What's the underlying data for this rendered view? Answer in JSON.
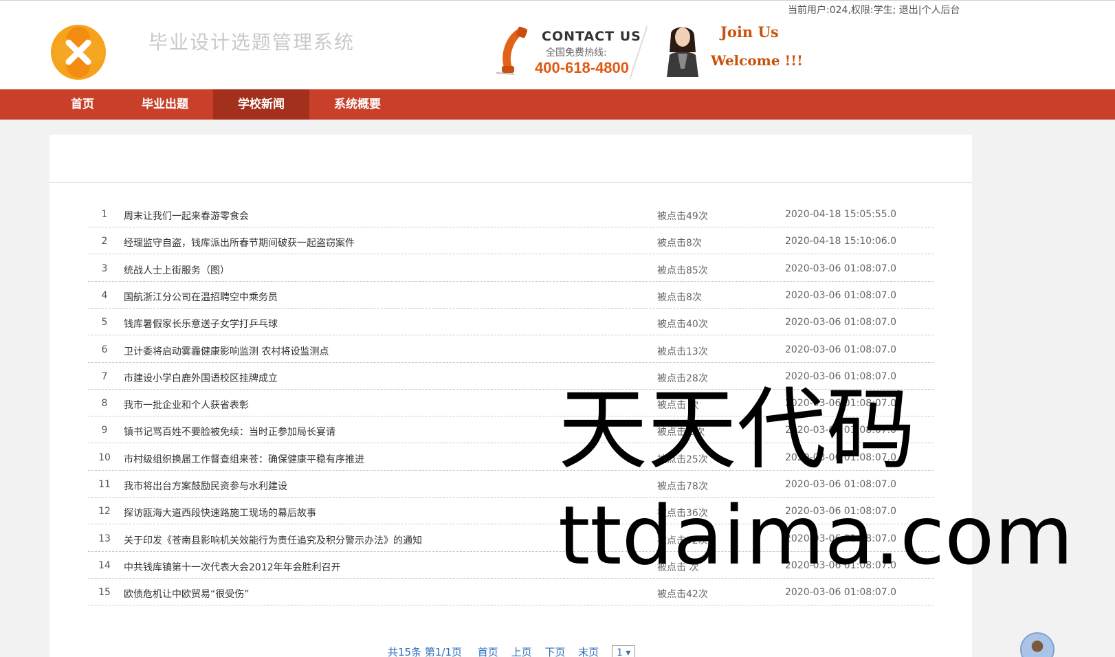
{
  "header": {
    "user_info": "当前用户:024,权限:学生;",
    "logout_label": "退出",
    "separator": "|",
    "dashboard_label": "个人后台",
    "site_title": "毕业设计选题管理系统",
    "contact_title": "CONTACT US",
    "contact_sub": "全国免费热线:",
    "contact_number": "400-618-4800",
    "join_us": "Join Us",
    "welcome": "Welcome !!!"
  },
  "nav": {
    "items": [
      {
        "label": "首页"
      },
      {
        "label": "毕业出题"
      },
      {
        "label": "学校新闻"
      },
      {
        "label": "系统概要"
      }
    ],
    "active_index": 2
  },
  "news": {
    "rows": [
      {
        "num": "1",
        "title": "周末让我们一起来春游零食会",
        "hits": "被点击49次",
        "date": "2020-04-18 15:05:55.0"
      },
      {
        "num": "2",
        "title": "经理监守自盗，钱库派出所春节期间破获一起盗窃案件",
        "hits": "被点击8次",
        "date": "2020-04-18 15:10:06.0"
      },
      {
        "num": "3",
        "title": "统战人士上街服务（图）",
        "hits": "被点击85次",
        "date": "2020-03-06 01:08:07.0"
      },
      {
        "num": "4",
        "title": "国航浙江分公司在温招聘空中乘务员",
        "hits": "被点击8次",
        "date": "2020-03-06 01:08:07.0"
      },
      {
        "num": "5",
        "title": "钱库暑假家长乐意送子女学打乒乓球",
        "hits": "被点击40次",
        "date": "2020-03-06 01:08:07.0"
      },
      {
        "num": "6",
        "title": "卫计委将启动雾霾健康影响监测 农村将设监测点",
        "hits": "被点击13次",
        "date": "2020-03-06 01:08:07.0"
      },
      {
        "num": "7",
        "title": "市建设小学白鹿外国语校区挂牌成立",
        "hits": "被点击28次",
        "date": "2020-03-06 01:08:07.0"
      },
      {
        "num": "8",
        "title": "我市一批企业和个人获省表彰",
        "hits": "被点击 次",
        "date": "2020-03-06 01:08:07.0"
      },
      {
        "num": "9",
        "title": "镇书记骂百姓不要脸被免续：当时正参加局长宴请",
        "hits": "被点击 0次",
        "date": "2020-03-06 01:08:07.0"
      },
      {
        "num": "10",
        "title": "市村级组织换届工作督查组来苍：确保健康平稳有序推进",
        "hits": "被点击25次",
        "date": "2020-03-06 01:08:07.0"
      },
      {
        "num": "11",
        "title": "我市将出台方案鼓励民资参与水利建设",
        "hits": "被点击78次",
        "date": "2020-03-06 01:08:07.0"
      },
      {
        "num": "12",
        "title": "探访瓯海大道西段快速路施工现场的幕后故事",
        "hits": "被点击36次",
        "date": "2020-03-06 01:08:07.0"
      },
      {
        "num": "13",
        "title": "关于印发《苍南县影响机关效能行为责任追究及积分警示办法》的通知",
        "hits": "被点击92次",
        "date": "2020-03-06 01:08:07.0"
      },
      {
        "num": "14",
        "title": "中共钱库镇第十一次代表大会2012年年会胜利召开",
        "hits": "被点击 次",
        "date": "2020-03-06 01:08:07.0"
      },
      {
        "num": "15",
        "title": "欧债危机让中欧贸易“很受伤”",
        "hits": "被点击42次",
        "date": "2020-03-06 01:08:07.0"
      }
    ]
  },
  "pager": {
    "info": "共15条 第1/1页",
    "first": "首页",
    "prev": "上页",
    "next": "下页",
    "last": "末页",
    "page_select": "1 ▾"
  },
  "watermark": {
    "line1": "天天代码",
    "line2": "ttdaima.com"
  },
  "colors": {
    "nav_bg": "#c9402a",
    "nav_active": "#a3301d",
    "accent_orange": "#e15a12"
  },
  "icons": [
    "logo-icon",
    "phone-icon",
    "woman-avatar-icon",
    "user-avatar-icon"
  ]
}
